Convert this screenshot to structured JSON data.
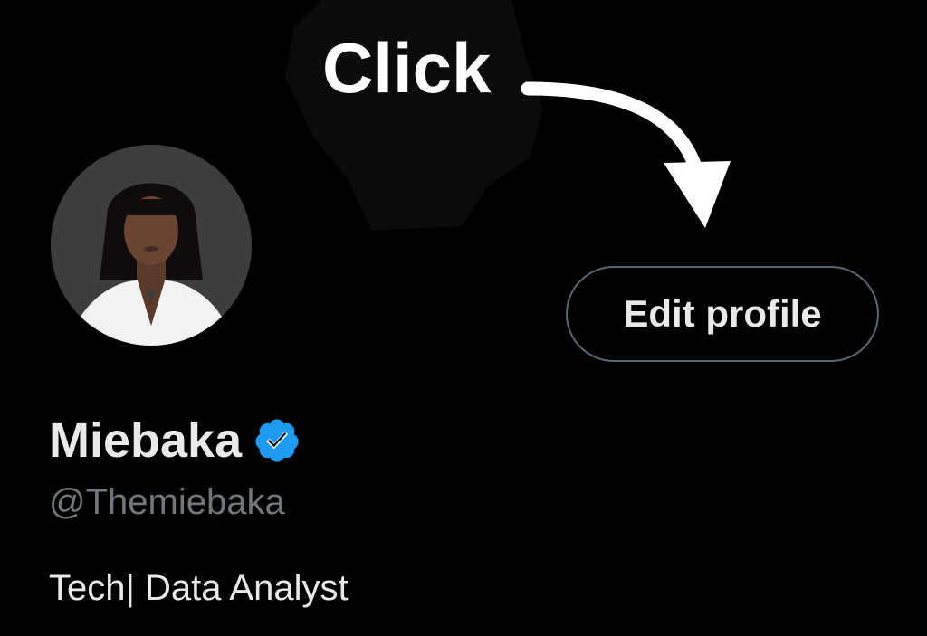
{
  "annotation": {
    "text": "Click"
  },
  "profile": {
    "display_name": "Miebaka",
    "handle": "@Themiebaka",
    "bio": "Tech| Data Analyst",
    "verified_icon": "verified-badge-icon"
  },
  "actions": {
    "edit_profile_label": "Edit profile"
  },
  "colors": {
    "background": "#000000",
    "primary_text": "#e7e9ea",
    "secondary_text": "#71767b",
    "verified_blue": "#1d9bf0",
    "button_border": "#5a6670",
    "annotation": "#ffffff"
  }
}
